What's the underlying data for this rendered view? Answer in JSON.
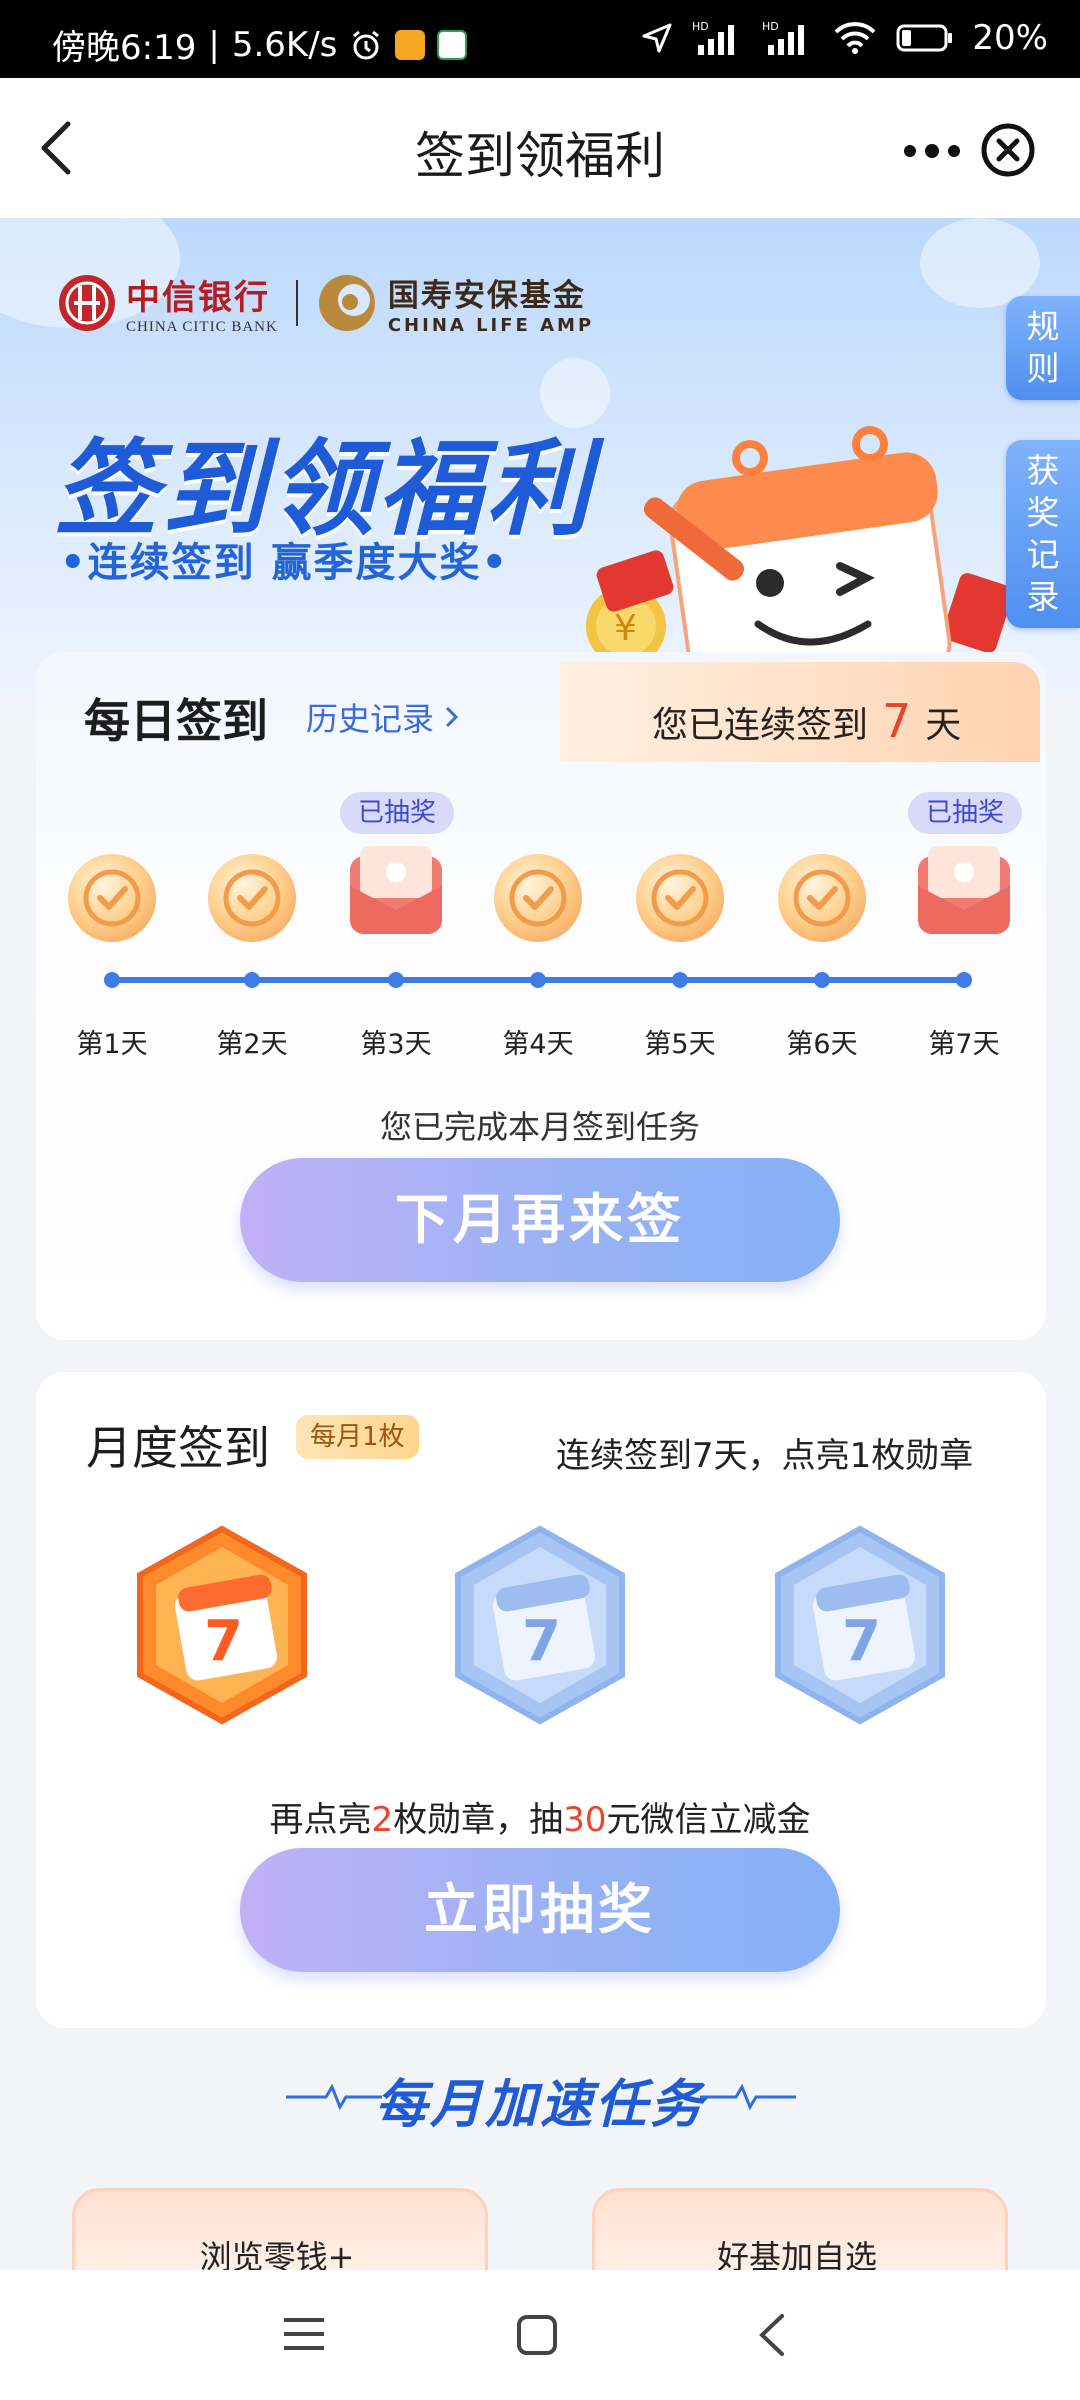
{
  "status_bar": {
    "time": "傍晚6:19",
    "net_speed": "5.6K/s",
    "battery": "20%",
    "network_label_1": "HD",
    "network_label_2": "HD"
  },
  "nav": {
    "title": "签到领福利"
  },
  "hero": {
    "bank_name_cn": "中信银行",
    "bank_name_en": "CHINA CITIC BANK",
    "fund_name_cn": "国寿安保基金",
    "fund_name_en": "CHINA LIFE AMP",
    "title": "签到领福利",
    "subtitle": "•连续签到 赢季度大奖•",
    "side_tab_rules": "规则",
    "side_tab_records": "获奖记录",
    "coin_symbol": "¥"
  },
  "daily": {
    "title": "每日签到",
    "history_link": "历史记录",
    "streak_prefix": "您已连续签到",
    "streak_days": "7",
    "streak_suffix": "天",
    "days": [
      {
        "label": "第1天",
        "state": "checked"
      },
      {
        "label": "第2天",
        "state": "checked"
      },
      {
        "label": "第3天",
        "state": "drawn",
        "badge": "已抽奖"
      },
      {
        "label": "第4天",
        "state": "checked"
      },
      {
        "label": "第5天",
        "state": "checked"
      },
      {
        "label": "第6天",
        "state": "checked"
      },
      {
        "label": "第7天",
        "state": "drawn",
        "badge": "已抽奖"
      }
    ],
    "complete_text": "您已完成本月签到任务",
    "button_label": "下月再来签"
  },
  "monthly": {
    "title": "月度签到",
    "tag": "每月1枚",
    "desc": "连续签到7天，点亮1枚勋章",
    "medal_number": "7",
    "medals": [
      {
        "state": "lit"
      },
      {
        "state": "unlit"
      },
      {
        "state": "unlit"
      }
    ],
    "lottery_text_1": "再点亮",
    "lottery_count": "2",
    "lottery_text_2": "枚勋章，抽",
    "lottery_amount": "30",
    "lottery_text_3": "元微信立减金",
    "button_label": "立即抽奖"
  },
  "speed_tasks": {
    "title": "每月加速任务",
    "tasks": [
      {
        "label": "浏览零钱+"
      },
      {
        "label": "好基加自选"
      }
    ]
  },
  "colors": {
    "brand_blue": "#1f5bd7",
    "accent_red": "#e8452e",
    "track_blue": "#3f7be4"
  }
}
